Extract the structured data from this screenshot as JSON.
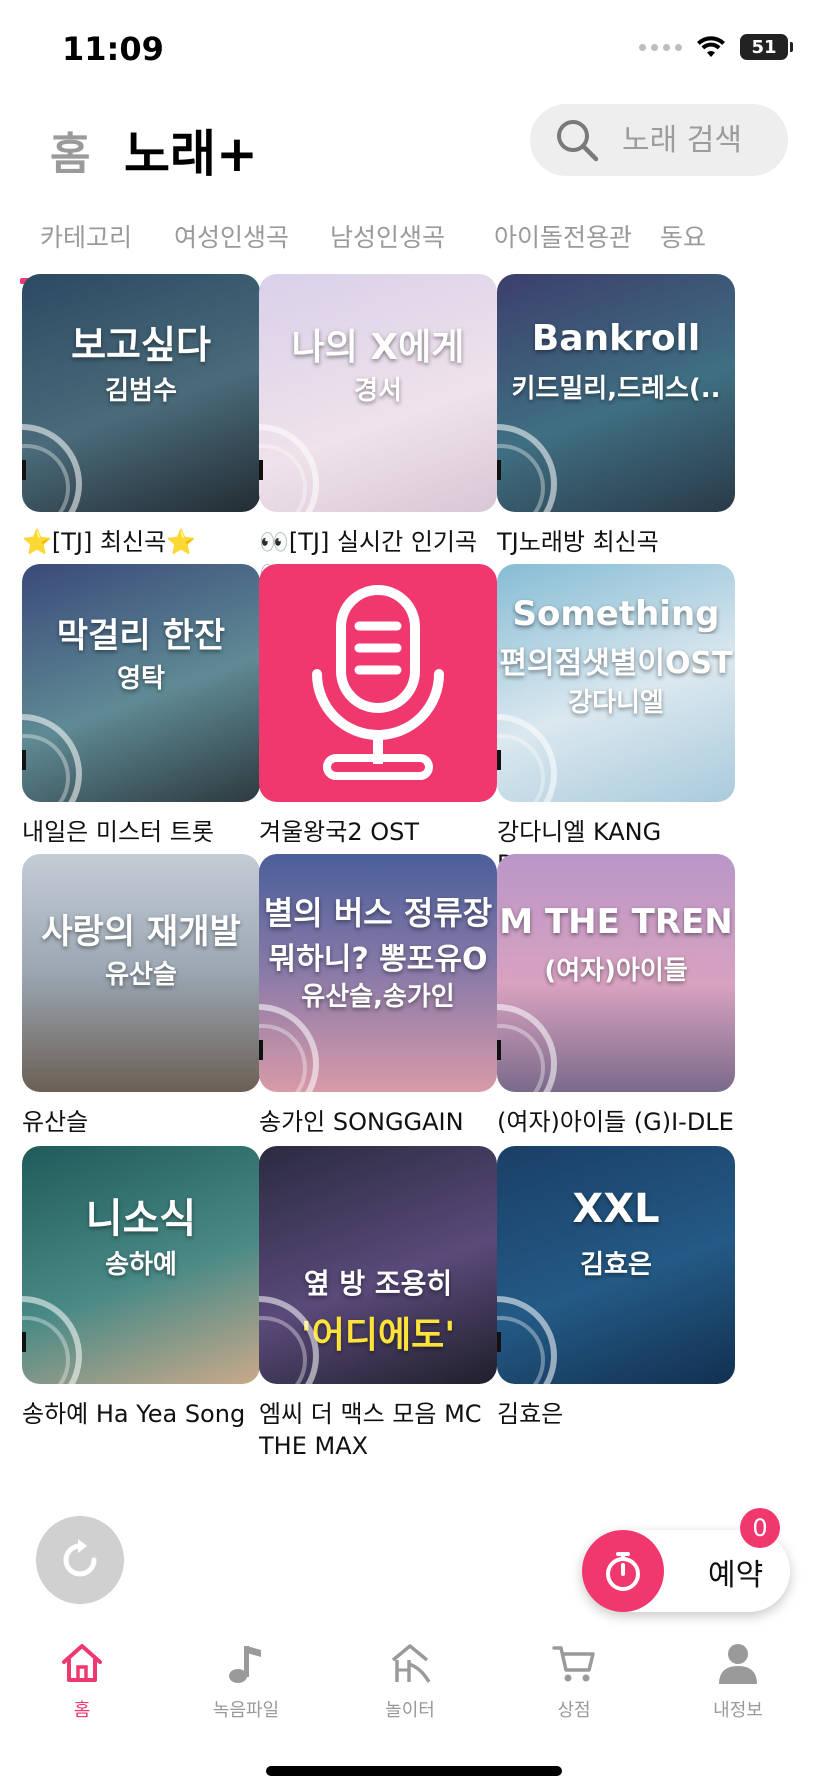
{
  "status_bar": {
    "time": "11:09",
    "battery": "51"
  },
  "header": {
    "home_label": "홈",
    "title": "노래+"
  },
  "search": {
    "placeholder": "노래 검색"
  },
  "tabs": [
    {
      "label": "카테고리",
      "active": true
    },
    {
      "label": "여성인생곡",
      "active": false
    },
    {
      "label": "남성인생곡",
      "active": false
    },
    {
      "label": "아이돌전용관",
      "active": false
    },
    {
      "label": "동요",
      "active": false
    }
  ],
  "grid": {
    "items": [
      {
        "thumb_title": "보고싶다",
        "thumb_artist": "김범수",
        "label": "⭐[TJ] 최신곡⭐",
        "colors": [
          "#2b4a63",
          "#7b8f95"
        ]
      },
      {
        "thumb_title": "나의 X에게",
        "thumb_artist": "경서",
        "label": "👀[TJ] 실시간 인기곡👀",
        "colors": [
          "#d8cfe6",
          "#f0dfe8"
        ]
      },
      {
        "thumb_title": "Bankroll",
        "thumb_artist": "키드밀리,드레스(..",
        "label": "TJ노래방 최신곡",
        "colors": [
          "#3c3f6c",
          "#3f7a88"
        ]
      },
      {
        "thumb_title": "막걸리 한잔",
        "thumb_artist": "영탁",
        "label": "내일은 미스터 트롯",
        "colors": [
          "#3a4a7a",
          "#6b8f95"
        ]
      },
      {
        "thumb_title": "",
        "thumb_artist": "",
        "label": "겨울왕국2 OST",
        "colors": [
          "#f0386f",
          "#f0386f"
        ]
      },
      {
        "thumb_title": "Something",
        "thumb_artist": "강다니엘",
        "thumb_sub": "편의점샛별이OST",
        "label": "강다니엘 KANG DANIEL",
        "colors": [
          "#8fc3d8",
          "#e5eef4"
        ]
      },
      {
        "thumb_title": "사랑의 재개발",
        "thumb_artist": "유산슬",
        "label": "유산슬",
        "colors": [
          "#b9c3cf",
          "#6b5f55"
        ]
      },
      {
        "thumb_title": "별의 버스 정류장",
        "thumb_sub": "뭐하니? 뽕포유O",
        "thumb_artist": "유산슬,송가인",
        "label": "송가인 SONGGAIN",
        "colors": [
          "#4a5f9a",
          "#d89aa8"
        ]
      },
      {
        "thumb_title": "M THE TREN",
        "thumb_artist": "(여자)아이들",
        "label": "(여자)아이들 (G)I-DLE",
        "colors": [
          "#b996c8",
          "#e6a6b7"
        ]
      },
      {
        "thumb_title": "니소식",
        "thumb_artist": "송하예",
        "label": "송하예 Ha Yea Song",
        "colors": [
          "#2f6f6a",
          "#c9a98a"
        ]
      },
      {
        "thumb_title": "옆 방 조용히",
        "thumb_artist": "'어디에도'",
        "label": "엠씨 더 맥스 모음 MC THE MAX",
        "colors": [
          "#3b3a52",
          "#8a6aa8"
        ]
      },
      {
        "thumb_title": "XXL",
        "thumb_artist": "김효은",
        "label": "김효은",
        "colors": [
          "#1d4f7a",
          "#2b6f9a"
        ]
      }
    ]
  },
  "reserve": {
    "label": "예약",
    "badge": "0"
  },
  "bottom_nav": [
    {
      "label": "홈",
      "icon": "home-icon",
      "active": true
    },
    {
      "label": "녹음파일",
      "icon": "music-note-icon",
      "active": false
    },
    {
      "label": "놀이터",
      "icon": "playground-icon",
      "active": false
    },
    {
      "label": "상점",
      "icon": "cart-icon",
      "active": false
    },
    {
      "label": "내정보",
      "icon": "profile-icon",
      "active": false
    }
  ],
  "accent_color": "#f0386f"
}
